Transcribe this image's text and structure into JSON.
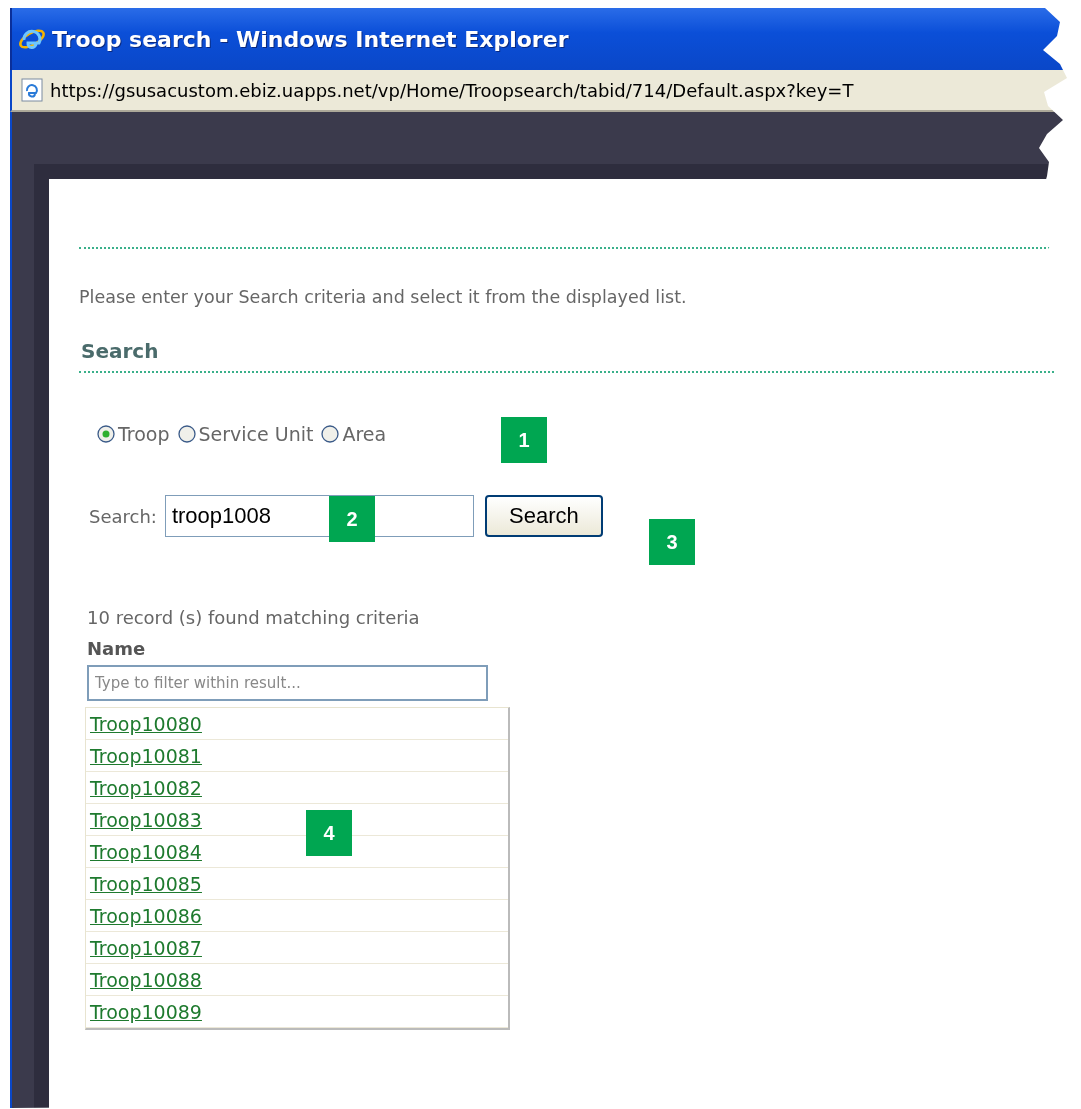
{
  "window": {
    "title": "Troop search - Windows Internet Explorer"
  },
  "address_bar": {
    "url": "https://gsusacustom.ebiz.uapps.net/vp/Home/Troopsearch/tabid/714/Default.aspx?key=T"
  },
  "instructions": "Please enter your Search criteria and select it from the displayed list.",
  "section_title": "Search",
  "search_type": [
    {
      "label": "Troop",
      "selected": true
    },
    {
      "label": "Service Unit",
      "selected": false
    },
    {
      "label": "Area",
      "selected": false
    }
  ],
  "search": {
    "label": "Search:",
    "value": "troop1008",
    "button": "Search"
  },
  "results": {
    "summary": "10 record (s) found matching criteria",
    "column": "Name",
    "filter": {
      "placeholder": "Type to filter within result..."
    },
    "rows": [
      "Troop10080",
      "Troop10081",
      "Troop10082",
      "Troop10083",
      "Troop10084",
      "Troop10085",
      "Troop10086",
      "Troop10087",
      "Troop10088",
      "Troop10089"
    ]
  },
  "callouts": [
    "1",
    "2",
    "3",
    "4"
  ]
}
